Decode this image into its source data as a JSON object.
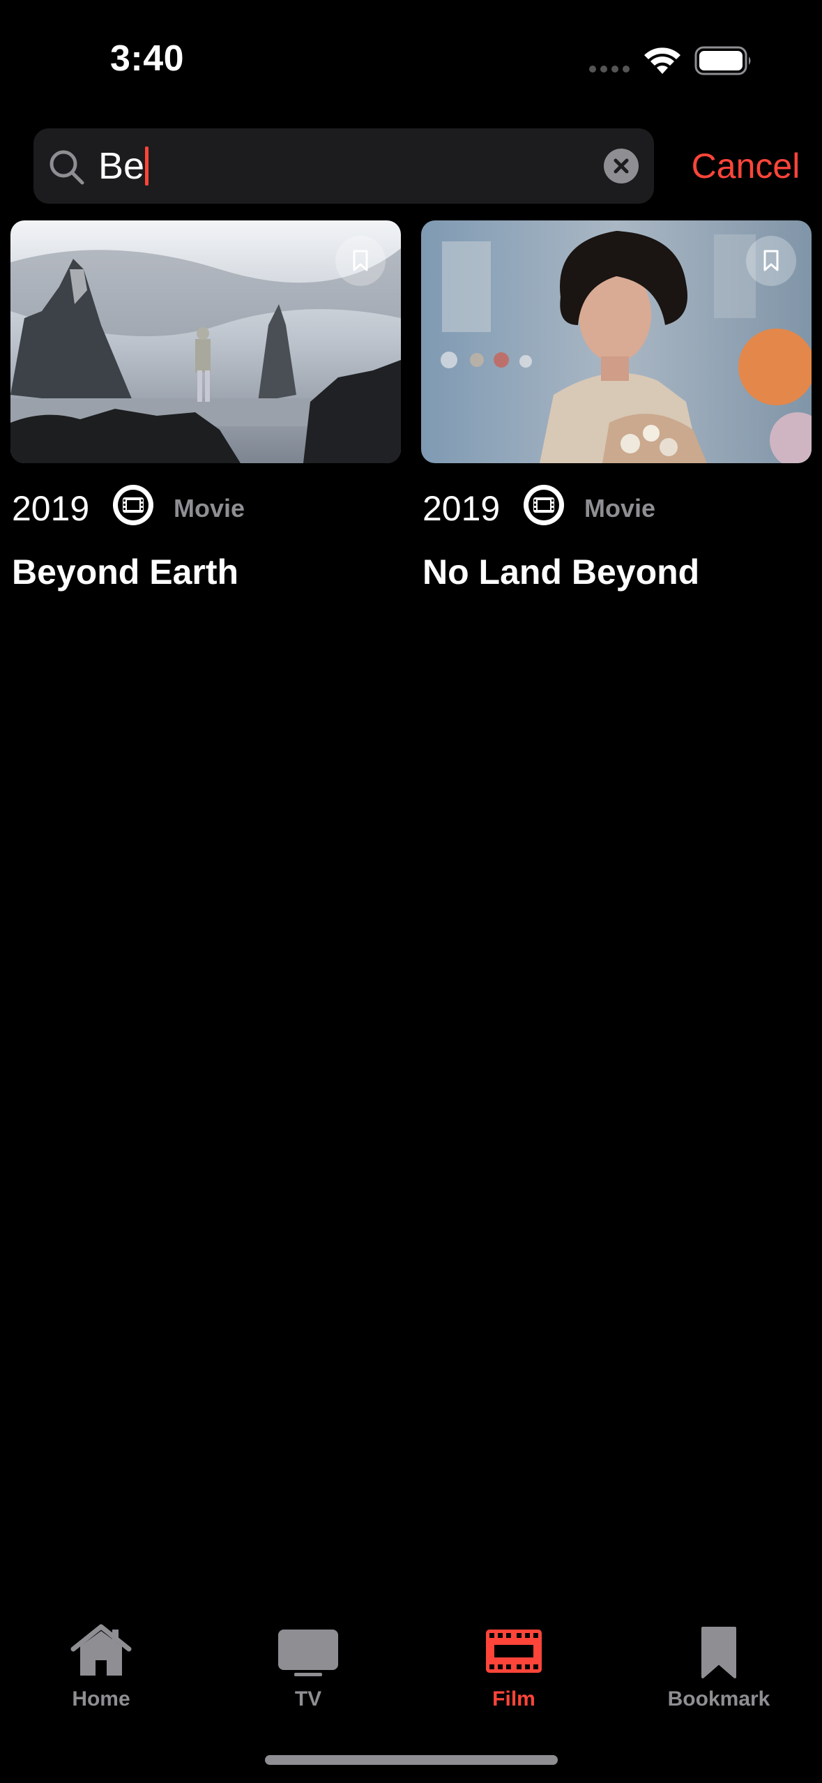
{
  "status_bar": {
    "time": "3:40",
    "icons": [
      "cellular-signal-icon",
      "wifi-icon",
      "battery-icon"
    ]
  },
  "search": {
    "value": "Be",
    "placeholder": "",
    "cancel_label": "Cancel",
    "icons": [
      "magnifier-icon",
      "clear-circle-icon"
    ]
  },
  "results": [
    {
      "year": "2019",
      "type": "Movie",
      "title": "Beyond Earth",
      "image": "photo of a hiker on rocky coastline with sea stacks",
      "icons": [
        "bookmark-icon",
        "film-reel-icon"
      ]
    },
    {
      "year": "2019",
      "type": "Movie",
      "title": "No Land Beyond",
      "image": "portrait of a curly-haired young man holding flowers",
      "icons": [
        "bookmark-icon",
        "film-reel-icon"
      ]
    }
  ],
  "tab_bar": {
    "tabs": [
      {
        "label": "Home",
        "icon": "house-icon",
        "active": false
      },
      {
        "label": "TV",
        "icon": "television-icon",
        "active": false
      },
      {
        "label": "Film",
        "icon": "film-strip-icon",
        "active": true
      },
      {
        "label": "Bookmark",
        "icon": "bookmark-icon",
        "active": false
      }
    ]
  },
  "colors": {
    "background": "#000000",
    "accent": "#ff453a",
    "search_field": "#1c1c1e",
    "secondary_text": "#8e8e93"
  }
}
